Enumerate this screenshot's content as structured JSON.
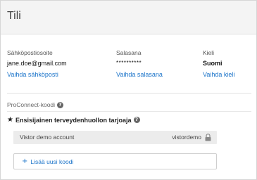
{
  "header": {
    "title": "Tili"
  },
  "account": {
    "email": {
      "label": "Sähköpostiosoite",
      "value": "jane.doe@gmail.com",
      "change_link": "Vaihda sähköposti"
    },
    "password": {
      "label": "Salasana",
      "value": "**********",
      "change_link": "Vaihda salasana"
    },
    "language": {
      "label": "Kieli",
      "value": "Suomi",
      "change_link": "Vaihda kieli"
    }
  },
  "proconnect": {
    "label": "ProConnect-koodi",
    "help_icon": "question-circle-icon",
    "primary_provider_label": "Ensisijainen terveydenhuollon tarjoaja",
    "star_icon": "star-icon",
    "accounts": [
      {
        "name": "Vistor demo account",
        "code": "vistordemo",
        "icon": "lock-icon"
      }
    ],
    "add_code_label": "Lisää uusi koodi",
    "add_icon": "plus-icon"
  },
  "colors": {
    "link": "#1a73c9",
    "header_bg": "#f4f4f4",
    "row_bg": "#ececec"
  }
}
